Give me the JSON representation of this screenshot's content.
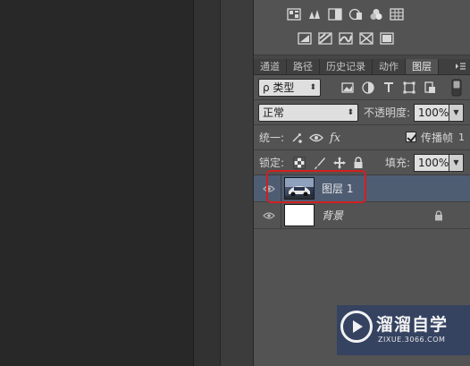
{
  "colors": {
    "panel_bg": "#535353",
    "selected_layer_bg": "#4f5d73",
    "highlight_border": "#d21f1f",
    "watermark_bg": "#1e376e"
  },
  "adjustments": {
    "row1_icons": [
      "brightness-contrast-icon",
      "levels-icon",
      "curves-icon",
      "exposure-icon",
      "vibrance-icon",
      "hue-saturation-icon"
    ],
    "row2_icons": [
      "invert-icon",
      "posterize-icon",
      "threshold-icon",
      "gradient-map-icon",
      "selective-color-icon"
    ]
  },
  "tabs": [
    {
      "label": "通道",
      "active": false
    },
    {
      "label": "路径",
      "active": false
    },
    {
      "label": "历史记录",
      "active": false
    },
    {
      "label": "动作",
      "active": false
    },
    {
      "label": "图层",
      "active": true
    }
  ],
  "filter": {
    "kind_label": "ρ 类型",
    "icons": [
      "pixel-filter-icon",
      "adjustment-filter-icon",
      "type-filter-icon",
      "shape-filter-icon",
      "smart-object-filter-icon"
    ]
  },
  "blend": {
    "mode": "正常",
    "opacity_label": "不透明度:",
    "opacity_value": "100%"
  },
  "unify": {
    "label": "统一:",
    "propagate_label": "传播帧",
    "propagate_value": "1",
    "propagate_checked": true
  },
  "lock": {
    "label": "锁定:",
    "fill_label": "填充:",
    "fill_value": "100%"
  },
  "layers": [
    {
      "name": "图层 1",
      "visible": true,
      "selected": true,
      "locked": false
    },
    {
      "name": "背景",
      "visible": true,
      "selected": false,
      "locked": true
    }
  ],
  "watermark": {
    "title": "溜溜自学",
    "url": "ZIXUE.3066.COM"
  }
}
